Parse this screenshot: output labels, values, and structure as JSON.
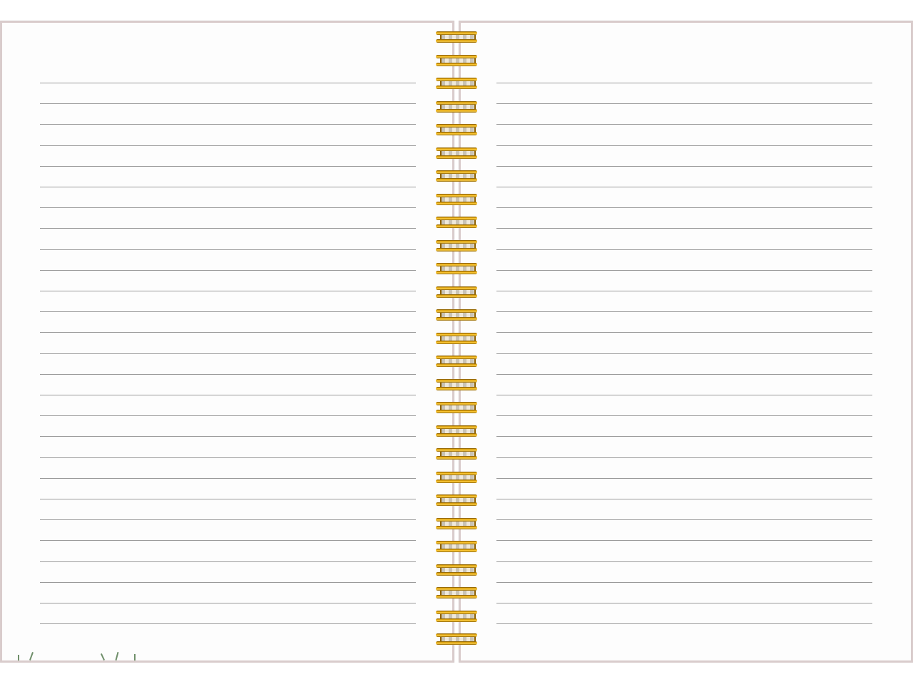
{
  "notebook": {
    "line_color": "#9a9a9a",
    "cover_color": "#d9cccc",
    "page_color": "#fdfdfd",
    "spiral_color": "#f3b414",
    "left_page": {
      "ruled_lines": 27
    },
    "right_page": {
      "ruled_lines": 27
    },
    "spiral": {
      "coils": 27
    },
    "decoration": "floral-print-icon"
  }
}
